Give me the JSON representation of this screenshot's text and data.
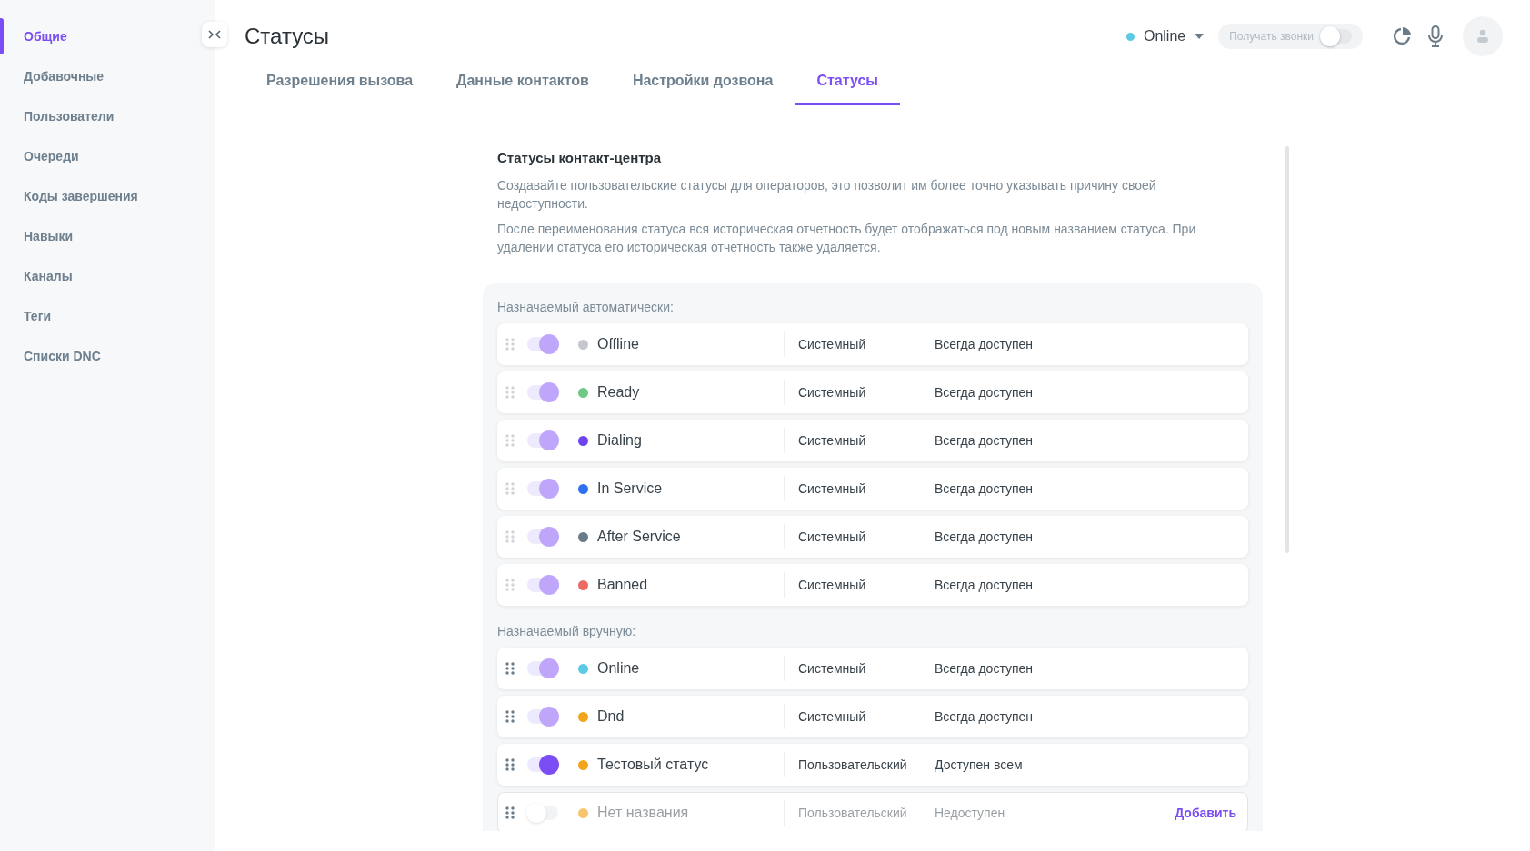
{
  "sidebar": {
    "items": [
      {
        "label": "Общие",
        "selected": true
      },
      {
        "label": "Добавочные",
        "selected": false
      },
      {
        "label": "Пользователи",
        "selected": false
      },
      {
        "label": "Очереди",
        "selected": false
      },
      {
        "label": "Коды завершения",
        "selected": false
      },
      {
        "label": "Навыки",
        "selected": false
      },
      {
        "label": "Каналы",
        "selected": false
      },
      {
        "label": "Теги",
        "selected": false
      },
      {
        "label": "Списки DNC",
        "selected": false
      }
    ]
  },
  "header": {
    "title": "Статусы",
    "status": {
      "label": "Online",
      "color": "#5bcbe3"
    },
    "receive_calls": {
      "label": "Получать звонки",
      "on": false
    }
  },
  "tabs": [
    {
      "label": "Разрешения вызова",
      "selected": false
    },
    {
      "label": "Данные контактов",
      "selected": false
    },
    {
      "label": "Настройки дозвона",
      "selected": false
    },
    {
      "label": "Статусы",
      "selected": true
    }
  ],
  "section": {
    "title": "Статусы контакт-центра",
    "paragraphs": [
      "Создавайте пользовательские статусы для операторов, это позволит им более точно указывать причину своей недоступности.",
      "После переименования статуса вся историческая отчетность будет отображаться под новым названием статуса. При удалении статуса его историческая отчетность также удаляется."
    ]
  },
  "groups": [
    {
      "label": "Назначаемый автоматически:",
      "rows": [
        {
          "name": "Offline",
          "color": "#c4c7cc",
          "type": "Системный",
          "availability": "Всегда доступен",
          "on": true,
          "kind": "system",
          "draggable": false,
          "disabled": false
        },
        {
          "name": "Ready",
          "color": "#6fc985",
          "type": "Системный",
          "availability": "Всегда доступен",
          "on": true,
          "kind": "system",
          "draggable": false,
          "disabled": false
        },
        {
          "name": "Dialing",
          "color": "#7043f0",
          "type": "Системный",
          "availability": "Всегда доступен",
          "on": true,
          "kind": "system",
          "draggable": false,
          "disabled": false
        },
        {
          "name": "In Service",
          "color": "#2f6ff0",
          "type": "Системный",
          "availability": "Всегда доступен",
          "on": true,
          "kind": "system",
          "draggable": false,
          "disabled": false
        },
        {
          "name": "After Service",
          "color": "#6b7c88",
          "type": "Системный",
          "availability": "Всегда доступен",
          "on": true,
          "kind": "system",
          "draggable": false,
          "disabled": false
        },
        {
          "name": "Banned",
          "color": "#eb6b63",
          "type": "Системный",
          "availability": "Всегда доступен",
          "on": true,
          "kind": "system",
          "draggable": false,
          "disabled": false
        }
      ]
    },
    {
      "label": "Назначаемый вручную:",
      "rows": [
        {
          "name": "Online",
          "color": "#5bcbe3",
          "type": "Системный",
          "availability": "Всегда доступен",
          "on": true,
          "kind": "system",
          "draggable": true,
          "disabled": false
        },
        {
          "name": "Dnd",
          "color": "#f2a51a",
          "type": "Системный",
          "availability": "Всегда доступен",
          "on": true,
          "kind": "system",
          "draggable": true,
          "disabled": false
        },
        {
          "name": "Тестовый статус",
          "color": "#f2a51a",
          "type": "Пользовательский",
          "availability": "Доступен всем",
          "on": true,
          "kind": "custom",
          "draggable": true,
          "disabled": false
        },
        {
          "name": "Нет названия",
          "color": "#f6c66e",
          "type": "Пользовательский",
          "availability": "Недоступен",
          "on": false,
          "kind": "custom",
          "draggable": true,
          "disabled": true,
          "action": "Добавить"
        }
      ]
    }
  ]
}
